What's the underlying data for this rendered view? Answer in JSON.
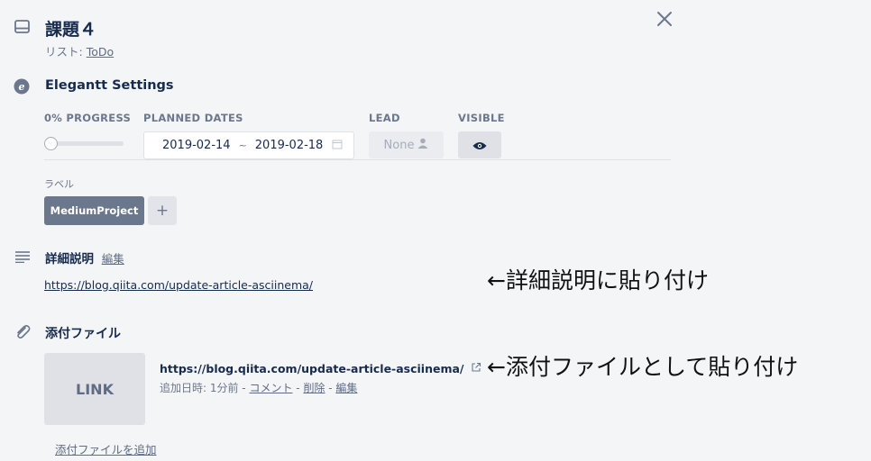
{
  "card": {
    "title": "課題４",
    "list_prefix": "リスト: ",
    "list_name": "ToDo"
  },
  "elegantt": {
    "section_title": "Elegantt Settings",
    "progress_label": "0% PROGRESS",
    "progress_value": 0,
    "planned_dates_label": "PLANNED DATES",
    "start_date": "2019-02-14",
    "date_separator": "~",
    "end_date": "2019-02-18",
    "lead_label": "LEAD",
    "lead_value": "None",
    "visible_label": "VISIBLE"
  },
  "labels": {
    "heading": "ラベル",
    "items": [
      "MediumProject"
    ],
    "add_symbol": "+"
  },
  "description": {
    "title": "詳細説明",
    "edit_link": "編集",
    "url": "https://blog.qiita.com/update-article-asciinema/"
  },
  "attachments": {
    "title": "添付ファイル",
    "thumb_text": "LINK",
    "item_url": "https://blog.qiita.com/update-article-asciinema/",
    "meta_prefix": "追加日時: 1分前 - ",
    "comment": "コメント",
    "delete": "削除",
    "edit": "編集",
    "sep": " - ",
    "add_link": "添付ファイルを追加"
  },
  "annotations": {
    "desc_note": "←詳細説明に貼り付け",
    "attach_note": "←添付ファイルとして貼り付け"
  },
  "icons": {
    "card": "card-icon",
    "close": "close-icon",
    "elegantt": "elegantt-logo-icon",
    "calendar": "calendar-icon",
    "user": "user-icon",
    "eye": "eye-icon",
    "description": "description-lines-icon",
    "attachment": "paperclip-icon",
    "external": "external-link-icon"
  }
}
